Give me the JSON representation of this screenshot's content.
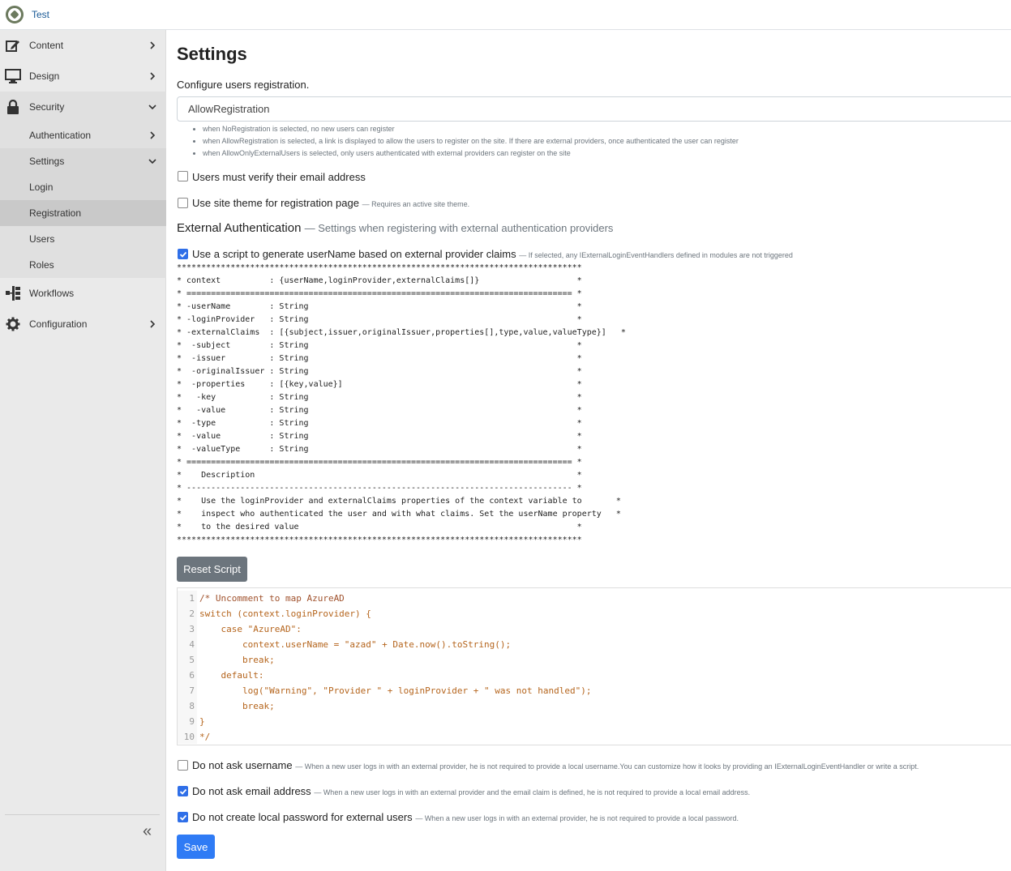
{
  "site": {
    "name": "Test"
  },
  "sidebar": {
    "items": [
      {
        "label": "Content",
        "icon": "edit-icon"
      },
      {
        "label": "Design",
        "icon": "monitor-icon"
      },
      {
        "label": "Security",
        "icon": "lock-icon"
      },
      {
        "label": "Workflows",
        "icon": "workflow-icon"
      },
      {
        "label": "Configuration",
        "icon": "gear-icon"
      }
    ],
    "security_sub": [
      {
        "label": "Authentication"
      },
      {
        "label": "Settings"
      }
    ],
    "settings_sub": [
      {
        "label": "Login"
      },
      {
        "label": "Registration"
      },
      {
        "label": "Users"
      },
      {
        "label": "Roles"
      }
    ],
    "collapse_glyph": "«"
  },
  "page": {
    "title": "Settings",
    "configure_label": "Configure users registration.",
    "registration_value": "AllowRegistration",
    "hints": [
      "when NoRegistration is selected, no new users can register",
      "when AllowRegistration is selected, a link is displayed to allow the users to register on the site. If there are external providers, once authenticated the user can register",
      "when AllowOnlyExternalUsers is selected, only users authenticated with external providers can register on the site"
    ],
    "verify_email_label": "Users must verify their email address",
    "site_theme_label": "Use site theme for registration page",
    "site_theme_hint": "— Requires an active site theme.",
    "external_title": "External Authentication",
    "external_hint": "— Settings when registering with external authentication providers",
    "script_label": "Use a script to generate userName based on external provider claims",
    "script_hint": "— If selected, any IExternalLoginEventHandlers defined in modules are not triggered",
    "doc_comment": "***********************************************************************************\n* context          : {userName,loginProvider,externalClaims[]}                    *\n* =============================================================================== *\n* -userName        : String                                                       *\n* -loginProvider   : String                                                       *\n* -externalClaims  : [{subject,issuer,originalIssuer,properties[],type,value,valueType}]   *\n*  -subject        : String                                                       *\n*  -issuer         : String                                                       *\n*  -originalIssuer : String                                                       *\n*  -properties     : [{key,value}]                                                *\n*   -key           : String                                                       *\n*   -value         : String                                                       *\n*  -type           : String                                                       *\n*  -value          : String                                                       *\n*  -valueType      : String                                                       *\n* =============================================================================== *\n*    Description                                                                  *\n* ------------------------------------------------------------------------------- *\n*    Use the loginProvider and externalClaims properties of the context variable to       *\n*    inspect who authenticated the user and with what claims. Set the userName property   *\n*    to the desired value                                                         *\n***********************************************************************************",
    "reset_script_label": "Reset Script",
    "code_lines": [
      {
        "num": "1",
        "text": "/* Uncomment to map AzureAD"
      },
      {
        "num": "2",
        "text": "switch (context.loginProvider) {"
      },
      {
        "num": "3",
        "text": "    case \"AzureAD\":"
      },
      {
        "num": "4",
        "text": "        context.userName = \"azad\" + Date.now().toString();"
      },
      {
        "num": "5",
        "text": "        break;"
      },
      {
        "num": "6",
        "text": "    default:"
      },
      {
        "num": "7",
        "text": "        log(\"Warning\", \"Provider \" + loginProvider + \" was not handled\");"
      },
      {
        "num": "8",
        "text": "        break;"
      },
      {
        "num": "9",
        "text": "}"
      },
      {
        "num": "10",
        "text": "*/"
      }
    ],
    "no_username_label": "Do not ask username",
    "no_username_hint": "— When a new user logs in with an external provider, he is not required to provide a local username.You can customize how it looks by providing an IExternalLoginEventHandler or write a script.",
    "no_email_label": "Do not ask email address",
    "no_email_hint": "— When a new user logs in with an external provider and the email claim is defined, he is not required to provide a local email address.",
    "no_password_label": "Do not create local password for external users",
    "no_password_hint": "— When a new user logs in with an external provider, he is not required to provide a local password.",
    "save_label": "Save",
    "checks": {
      "verify_email": false,
      "site_theme": false,
      "script": true,
      "no_username": false,
      "no_email": true,
      "no_password": true
    }
  },
  "colors": {
    "accent": "#2f7bf5",
    "sidebar_bg": "#eaeaea",
    "sidebar_active": "#d6d6d6",
    "secondary_button": "#6c757d"
  }
}
